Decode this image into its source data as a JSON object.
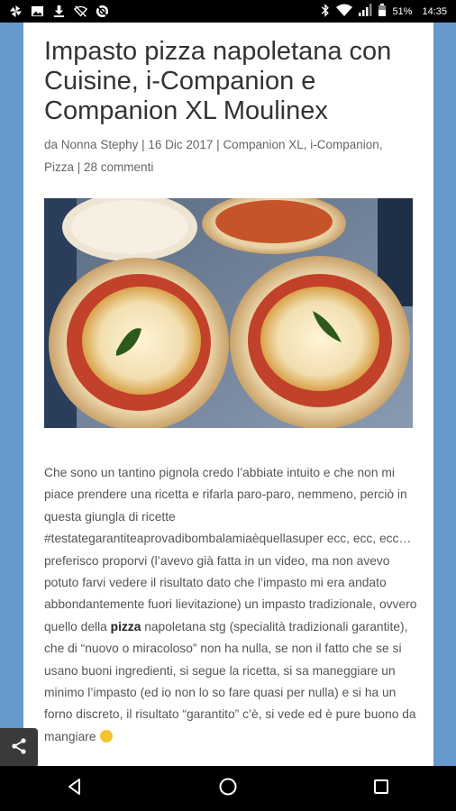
{
  "status_bar": {
    "battery": "51%",
    "time": "14:35",
    "left_icons": [
      "pinwheel-icon",
      "image-icon",
      "download-icon",
      "wifi-off-icon",
      "no-sync-icon"
    ],
    "right_icons": [
      "bluetooth-icon",
      "wifi-icon",
      "signal-icon",
      "battery-icon"
    ]
  },
  "article": {
    "title": "Impasto pizza napoletana con Cuisine, i-Companion e Companion XL Moulinex",
    "meta": {
      "prefix": "da ",
      "author": "Nonna Stephy",
      "sep1": " | ",
      "date": "16 Dic 2017",
      "sep2": " | ",
      "cat1": "Companion XL",
      "comma1": ", ",
      "cat2": "i-Companion",
      "comma2": ", ",
      "cat3": "Pizza",
      "sep3": " | ",
      "comments": "28 commenti"
    },
    "image_alt": "Pizze napoletane margherita",
    "body_part1": "Che sono un tantino pignola credo l’abbiate intuito e che non mi piace prendere una ricetta e rifarla paro-paro, nemmeno, perciò in questa giungla di ricette #testategarantiteaprovadibombalamiaèquellasuper ecc, ecc, ecc… preferisco proporvi (l’avevo già fatta in un video, ma non avevo potuto farvi vedere il risultato dato che l’impasto mi era andato abbondantemente fuori lievitazione) un impasto tradizionale, ovvero quello della ",
    "body_bold": "pizza",
    "body_part2": " napoletana stg (specialità tradizionali garantite), che di “nuovo o miracoloso” non ha nulla, se non il fatto che se si usano buoni ingredienti, si segue la ricetta, si sa maneggiare un minimo l’impasto (ed io non lo so fare quasi per nulla) e si ha un forno discreto, il risultato “garantito” c’è, si vede ed è pure buono da mangiare"
  },
  "nav": {
    "back": "back-icon",
    "home": "home-icon",
    "recents": "recents-icon"
  },
  "fab": "share-icon",
  "colors": {
    "side_bg": "#6699cc",
    "title": "#333333",
    "text": "#555555"
  }
}
